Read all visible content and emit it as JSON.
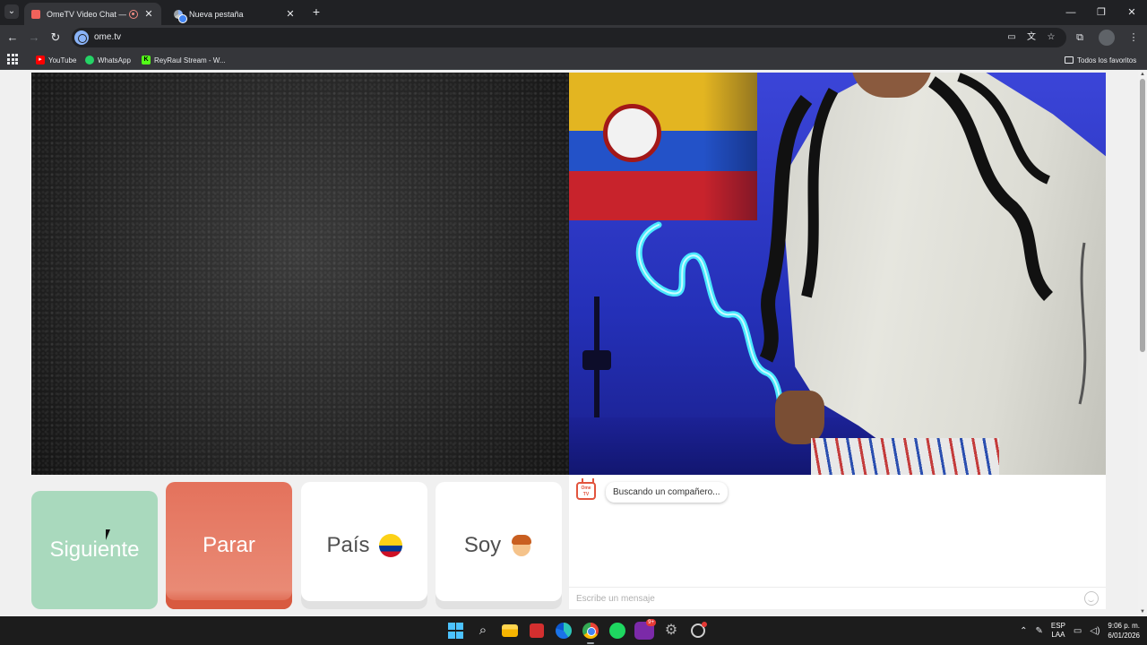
{
  "browser": {
    "tabs": [
      {
        "title": "OmeTV Video Chat — Omegle",
        "active": true
      },
      {
        "title": "Nueva pestaña",
        "active": false
      }
    ],
    "url": "ome.tv",
    "bookmarks": [
      {
        "label": "YouTube",
        "icon": "youtube-icon",
        "color": "#ff0000"
      },
      {
        "label": "WhatsApp",
        "icon": "whatsapp-icon",
        "color": "#25d366"
      },
      {
        "label": "ReyRaul Stream - W...",
        "icon": "kick-icon",
        "color": "#53fc18"
      }
    ],
    "bookmarks_folder": "Todos los favoritos"
  },
  "controls": {
    "next_label": "Siguiente",
    "stop_label": "Parar",
    "country_label": "País",
    "gender_label": "Soy"
  },
  "chat": {
    "status_message": "Buscando un compañero...",
    "input_placeholder": "Escribe un mensaje"
  },
  "taskbar": {
    "language": "ESP",
    "layout": "LAA",
    "time": "9:06 p. m.",
    "date": "6/01/2026",
    "discord_badge": "9+"
  },
  "colors": {
    "next_button": "#a9d9bd",
    "stop_button": "#e4725c",
    "accent": "#e2543d"
  }
}
